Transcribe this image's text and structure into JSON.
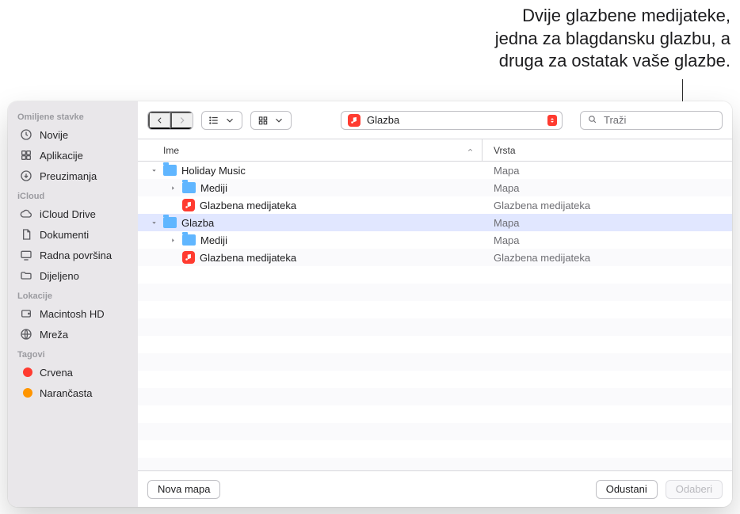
{
  "callout": {
    "line1": "Dvije glazbene medijateke,",
    "line2": "jedna za blagdansku glazbu, a",
    "line3": "druga za ostatak vaše glazbe."
  },
  "sidebar": {
    "sections": [
      {
        "title": "Omiljene stavke",
        "items": [
          {
            "label": "Novije",
            "icon": "clock-icon"
          },
          {
            "label": "Aplikacije",
            "icon": "apps-icon"
          },
          {
            "label": "Preuzimanja",
            "icon": "download-icon"
          }
        ]
      },
      {
        "title": "iCloud",
        "items": [
          {
            "label": "iCloud Drive",
            "icon": "cloud-icon"
          },
          {
            "label": "Dokumenti",
            "icon": "doc-icon"
          },
          {
            "label": "Radna površina",
            "icon": "desktop-icon"
          },
          {
            "label": "Dijeljeno",
            "icon": "shared-folder-icon"
          }
        ]
      },
      {
        "title": "Lokacije",
        "items": [
          {
            "label": "Macintosh HD",
            "icon": "disk-icon"
          },
          {
            "label": "Mreža",
            "icon": "globe-icon"
          }
        ]
      },
      {
        "title": "Tagovi",
        "items": [
          {
            "label": "Crvena",
            "color": "#ff3b30"
          },
          {
            "label": "Narančasta",
            "color": "#ff9500"
          }
        ]
      }
    ]
  },
  "toolbar": {
    "path_label": "Glazba",
    "path_icon": "music-icon",
    "search_placeholder": "Traži"
  },
  "columns": {
    "name": "Ime",
    "kind": "Vrsta",
    "sort_column": "name",
    "sort_direction": "asc"
  },
  "rows": [
    {
      "indent": 0,
      "expanded": true,
      "icon": "folder",
      "name": "Holiday Music",
      "kind": "Mapa",
      "selected": false
    },
    {
      "indent": 1,
      "expanded": false,
      "icon": "folder",
      "name": "Mediji",
      "kind": "Mapa",
      "selected": false
    },
    {
      "indent": 1,
      "expanded": null,
      "icon": "music",
      "name": "Glazbena medijateka",
      "kind": "Glazbena medijateka",
      "selected": false
    },
    {
      "indent": 0,
      "expanded": true,
      "icon": "folder",
      "name": "Glazba",
      "kind": "Mapa",
      "selected": true
    },
    {
      "indent": 1,
      "expanded": false,
      "icon": "folder",
      "name": "Mediji",
      "kind": "Mapa",
      "selected": false
    },
    {
      "indent": 1,
      "expanded": null,
      "icon": "music",
      "name": "Glazbena medijateka",
      "kind": "Glazbena medijateka",
      "selected": false
    }
  ],
  "footer": {
    "new_folder": "Nova mapa",
    "cancel": "Odustani",
    "choose": "Odaberi",
    "choose_enabled": false
  },
  "colors": {
    "accent": "#0a7aff",
    "red": "#ff3b30",
    "orange": "#ff9500",
    "folder": "#60b6ff"
  }
}
